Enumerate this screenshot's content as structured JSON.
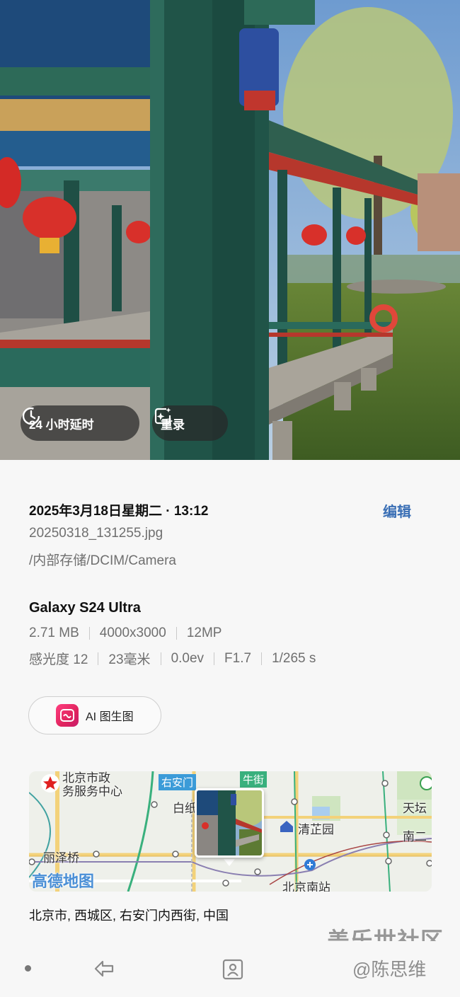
{
  "photo_chips": {
    "history_label": "24 小时延时",
    "remaster_label": "重录"
  },
  "details": {
    "date": "2025年3月18日星期二 · 13:12",
    "edit_label": "编辑",
    "filename": "20250318_131255.jpg",
    "path": "/内部存储/DCIM/Camera",
    "device": "Galaxy S24 Ultra",
    "specs_row1": [
      "2.71 MB",
      "4000x3000",
      "12MP"
    ],
    "specs_row2": [
      "感光度 12",
      "23毫米",
      "0.0ev",
      "F1.7",
      "1/265 s"
    ],
    "ai_button_label": "AI 图生图"
  },
  "map": {
    "labels": {
      "poi_top_left": "北京市政\n务服务中心",
      "youanmen": "右安门",
      "niujie": "牛街",
      "bai": "白纸",
      "qingzhiyuan": "清芷园",
      "tiantan": "天坛",
      "nan": "南二",
      "lizeqiao": "丽泽桥",
      "beijingnanzhan": "北京南站"
    },
    "brand": "高德地图",
    "address": "北京市, 西城区, 右安门内西街, 中国"
  },
  "watermark": {
    "community": "盖乐世社区",
    "author": "@陈思维"
  },
  "colors": {
    "accent_blue": "#3a6fb5",
    "ai_pink": "#e0245e"
  }
}
